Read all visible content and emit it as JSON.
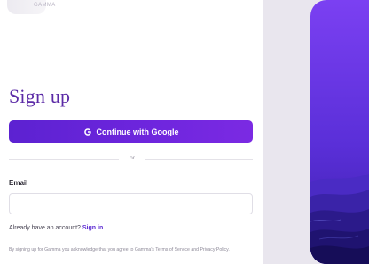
{
  "brand": {
    "logo_text": "GAMMA"
  },
  "form": {
    "title": "Sign up",
    "google_button_label": "Continue with Google",
    "divider_text": "or",
    "email_label": "Email",
    "email_value": "",
    "already_prefix": "Already have an account? ",
    "sign_in_link": "Sign in",
    "terms_prefix": "By signing up for Gamma you acknowledge that you agree to Gamma's ",
    "terms_link": "Terms of Service",
    "terms_and": " and ",
    "privacy_link": "Privacy Policy",
    "terms_suffix": "."
  },
  "colors": {
    "accent": "#6a24dc",
    "title": "#5b2aa6",
    "art_top": "#7a3ef0",
    "art_bottom": "#1a0d5c"
  },
  "icons": {
    "google": "google-icon"
  }
}
